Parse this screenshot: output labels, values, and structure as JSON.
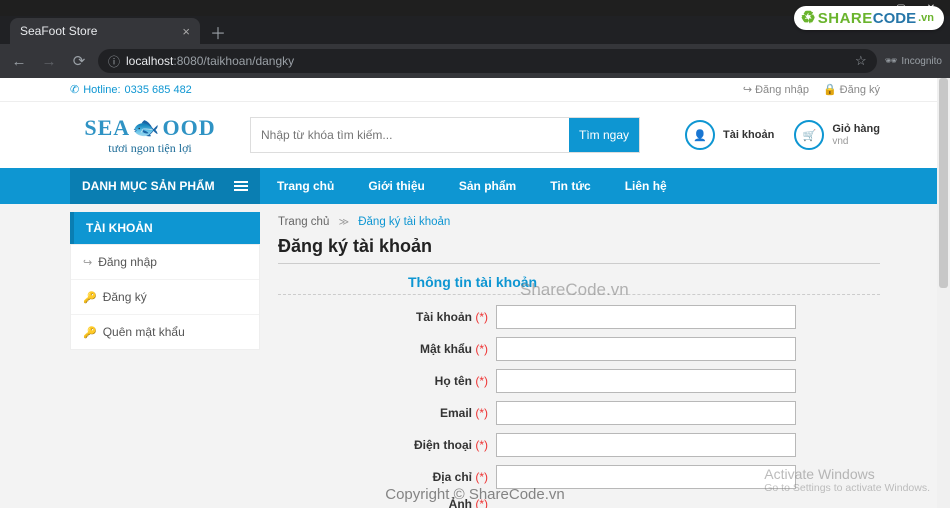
{
  "window": {
    "tab_title": "SeaFoot Store",
    "url_host": "localhost",
    "url_port": ":8080",
    "url_path": "/taikhoan/dangky",
    "incognito_label": "Incognito"
  },
  "badge": {
    "t1": "SHARE",
    "t2": "CODE",
    "vn": ".vn"
  },
  "topmini": {
    "hotline_label": "Hotline: ",
    "hotline_number": "0335 685 482",
    "login": "Đăng nhập",
    "register": "Đăng ký"
  },
  "logo": {
    "row1a": "SEA",
    "row1b": "OOD",
    "row2": "tươi ngon      tiện lợi"
  },
  "search": {
    "placeholder": "Nhập từ khóa tìm kiếm...",
    "btn": "Tìm ngay"
  },
  "acct": {
    "account": "Tài khoản",
    "cart": "Giỏ hàng",
    "cart_sub": "vnd"
  },
  "nav": {
    "cat": "DANH MỤC SẢN PHẨM",
    "items": [
      "Trang chủ",
      "Giới thiệu",
      "Sản phẩm",
      "Tin tức",
      "Liên hệ"
    ]
  },
  "sidebar": {
    "title": "TÀI KHOẢN",
    "items": [
      {
        "icon": "↪",
        "label": "Đăng nhập"
      },
      {
        "icon": "🔑",
        "label": "Đăng ký"
      },
      {
        "icon": "🔑",
        "label": "Quên mật khẩu"
      }
    ]
  },
  "crumbs": {
    "home": "Trang chủ",
    "here": "Đăng ký tài khoản"
  },
  "page": {
    "title": "Đăng ký tài khoản",
    "section": "Thông tin tài khoản",
    "fields": [
      {
        "label": "Tài khoản"
      },
      {
        "label": "Mật khẩu"
      },
      {
        "label": "Họ tên"
      },
      {
        "label": "Email"
      },
      {
        "label": "Điện thoại"
      },
      {
        "label": "Địa chỉ"
      }
    ],
    "trailing_label": "Ảnh"
  },
  "wm": {
    "center": "ShareCode.vn",
    "bottom": "Copyright © ShareCode.vn",
    "act1": "Activate Windows",
    "act2": "Go to Settings to activate Windows."
  }
}
